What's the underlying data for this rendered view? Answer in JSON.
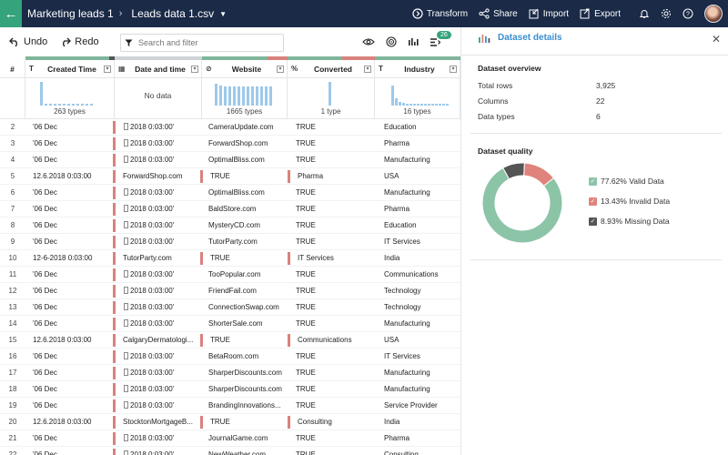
{
  "topbar": {
    "breadcrumb_project": "Marketing leads 1",
    "breadcrumb_file": "Leads data 1.csv",
    "actions": {
      "transform": "Transform",
      "share": "Share",
      "import": "Import",
      "export": "Export"
    },
    "icons": [
      "back-arrow-icon",
      "bell-icon",
      "gear-icon",
      "help-icon"
    ]
  },
  "toolbar": {
    "undo": "Undo",
    "redo": "Redo",
    "search_placeholder": "Search and filter",
    "badge_count": "26"
  },
  "grid": {
    "row_num_header": "#",
    "columns": [
      {
        "name": "Created Time",
        "type_icon": "T",
        "summary": "263 types"
      },
      {
        "name": "Date and time",
        "type_icon": "calendar",
        "summary": "No data"
      },
      {
        "name": "Website",
        "type_icon": "link",
        "summary": "1665 types"
      },
      {
        "name": "Converted",
        "type_icon": "%",
        "summary": "1 type"
      },
      {
        "name": "Industry",
        "type_icon": "T",
        "summary": "16 types"
      }
    ],
    "rows": [
      {
        "n": "2",
        "created": "'06 Dec",
        "date": "2018 0:03:00'",
        "site": "CameraUpdate.com",
        "conv": "TRUE",
        "ind": "Education",
        "shift": false
      },
      {
        "n": "3",
        "created": "'06 Dec",
        "date": "2018 0:03:00'",
        "site": "ForwardShop.com",
        "conv": "TRUE",
        "ind": "Pharma",
        "shift": false
      },
      {
        "n": "4",
        "created": "'06 Dec",
        "date": "2018 0:03:00'",
        "site": "OptimalBliss.com",
        "conv": "TRUE",
        "ind": "Manufacturing",
        "shift": false
      },
      {
        "n": "5",
        "created": "12.6.2018 0:03:00",
        "date": "ForwardShop.com",
        "site": "TRUE",
        "conv": "Pharma",
        "ind": "USA",
        "shift": true
      },
      {
        "n": "6",
        "created": "'06 Dec",
        "date": "2018 0:03:00'",
        "site": "OptimalBliss.com",
        "conv": "TRUE",
        "ind": "Manufacturing",
        "shift": false
      },
      {
        "n": "7",
        "created": "'06 Dec",
        "date": "2018 0:03:00'",
        "site": "BaldStore.com",
        "conv": "TRUE",
        "ind": "Pharma",
        "shift": false
      },
      {
        "n": "8",
        "created": "'06 Dec",
        "date": "2018 0:03:00'",
        "site": "MysteryCD.com",
        "conv": "TRUE",
        "ind": "Education",
        "shift": false
      },
      {
        "n": "9",
        "created": "'06 Dec",
        "date": "2018 0:03:00'",
        "site": "TutorParty.com",
        "conv": "TRUE",
        "ind": "IT Services",
        "shift": false
      },
      {
        "n": "10",
        "created": "12-6-2018 0:03:00",
        "date": "TutorParty.com",
        "site": "TRUE",
        "conv": "IT Services",
        "ind": "India",
        "shift": true
      },
      {
        "n": "11",
        "created": "'06 Dec",
        "date": "2018 0:03:00'",
        "site": "TooPopular.com",
        "conv": "TRUE",
        "ind": "Communications",
        "shift": false
      },
      {
        "n": "12",
        "created": "'06 Dec",
        "date": "2018 0:03:00'",
        "site": "FriendFail.com",
        "conv": "TRUE",
        "ind": "Technology",
        "shift": false
      },
      {
        "n": "13",
        "created": "'06 Dec",
        "date": "2018 0:03:00'",
        "site": "ConnectionSwap.com",
        "conv": "TRUE",
        "ind": "Technology",
        "shift": false
      },
      {
        "n": "14",
        "created": "'06 Dec",
        "date": "2018 0:03:00'",
        "site": "ShorterSale.com",
        "conv": "TRUE",
        "ind": "Manufacturing",
        "shift": false
      },
      {
        "n": "15",
        "created": "12.6.2018 0:03:00",
        "date": "CalgaryDermatologi...",
        "site": "TRUE",
        "conv": "Communications",
        "ind": "USA",
        "shift": true
      },
      {
        "n": "16",
        "created": "'06 Dec",
        "date": "2018 0:03:00'",
        "site": "BetaRoom.com",
        "conv": "TRUE",
        "ind": "IT Services",
        "shift": false
      },
      {
        "n": "17",
        "created": "'06 Dec",
        "date": "2018 0:03:00'",
        "site": "SharperDiscounts.com",
        "conv": "TRUE",
        "ind": "Manufacturing",
        "shift": false
      },
      {
        "n": "18",
        "created": "'06 Dec",
        "date": "2018 0:03:00'",
        "site": "SharperDiscounts.com",
        "conv": "TRUE",
        "ind": "Manufacturing",
        "shift": false
      },
      {
        "n": "19",
        "created": "'06 Dec",
        "date": "2018 0:03:00'",
        "site": "BrandingInnovations...",
        "conv": "TRUE",
        "ind": "Service Provider",
        "shift": false
      },
      {
        "n": "20",
        "created": "12.6.2018 0:03:00",
        "date": "StocktonMortgageB...",
        "site": "TRUE",
        "conv": "Consulting",
        "ind": "India",
        "shift": true
      },
      {
        "n": "21",
        "created": "'06 Dec",
        "date": "2018 0:03:00'",
        "site": "JournalGame.com",
        "conv": "TRUE",
        "ind": "Pharma",
        "shift": false
      },
      {
        "n": "22",
        "created": "'06 Dec",
        "date": "2018 0:03:00'",
        "site": "NewWeather.com",
        "conv": "TRUE",
        "ind": "Consulting",
        "shift": false
      }
    ]
  },
  "panel": {
    "title": "Dataset details",
    "overview_title": "Dataset overview",
    "overview": [
      {
        "label": "Total rows",
        "value": "3,925"
      },
      {
        "label": "Columns",
        "value": "22"
      },
      {
        "label": "Data types",
        "value": "6"
      }
    ],
    "quality_title": "Dataset quality",
    "quality": [
      {
        "label": "77.62% Valid Data",
        "pct": 77.62,
        "color": "#8cc4a7"
      },
      {
        "label": "13.43% Invalid Data",
        "pct": 13.43,
        "color": "#e0837c"
      },
      {
        "label": "8.93% Missing Data",
        "pct": 8.93,
        "color": "#555555"
      }
    ]
  },
  "colors": {
    "topbar": "#1a2a47",
    "accent_green": "#35a37b",
    "accent_blue": "#3a8fd0",
    "invalid_red": "#d9827d",
    "histogram": "#9dc9ea"
  }
}
